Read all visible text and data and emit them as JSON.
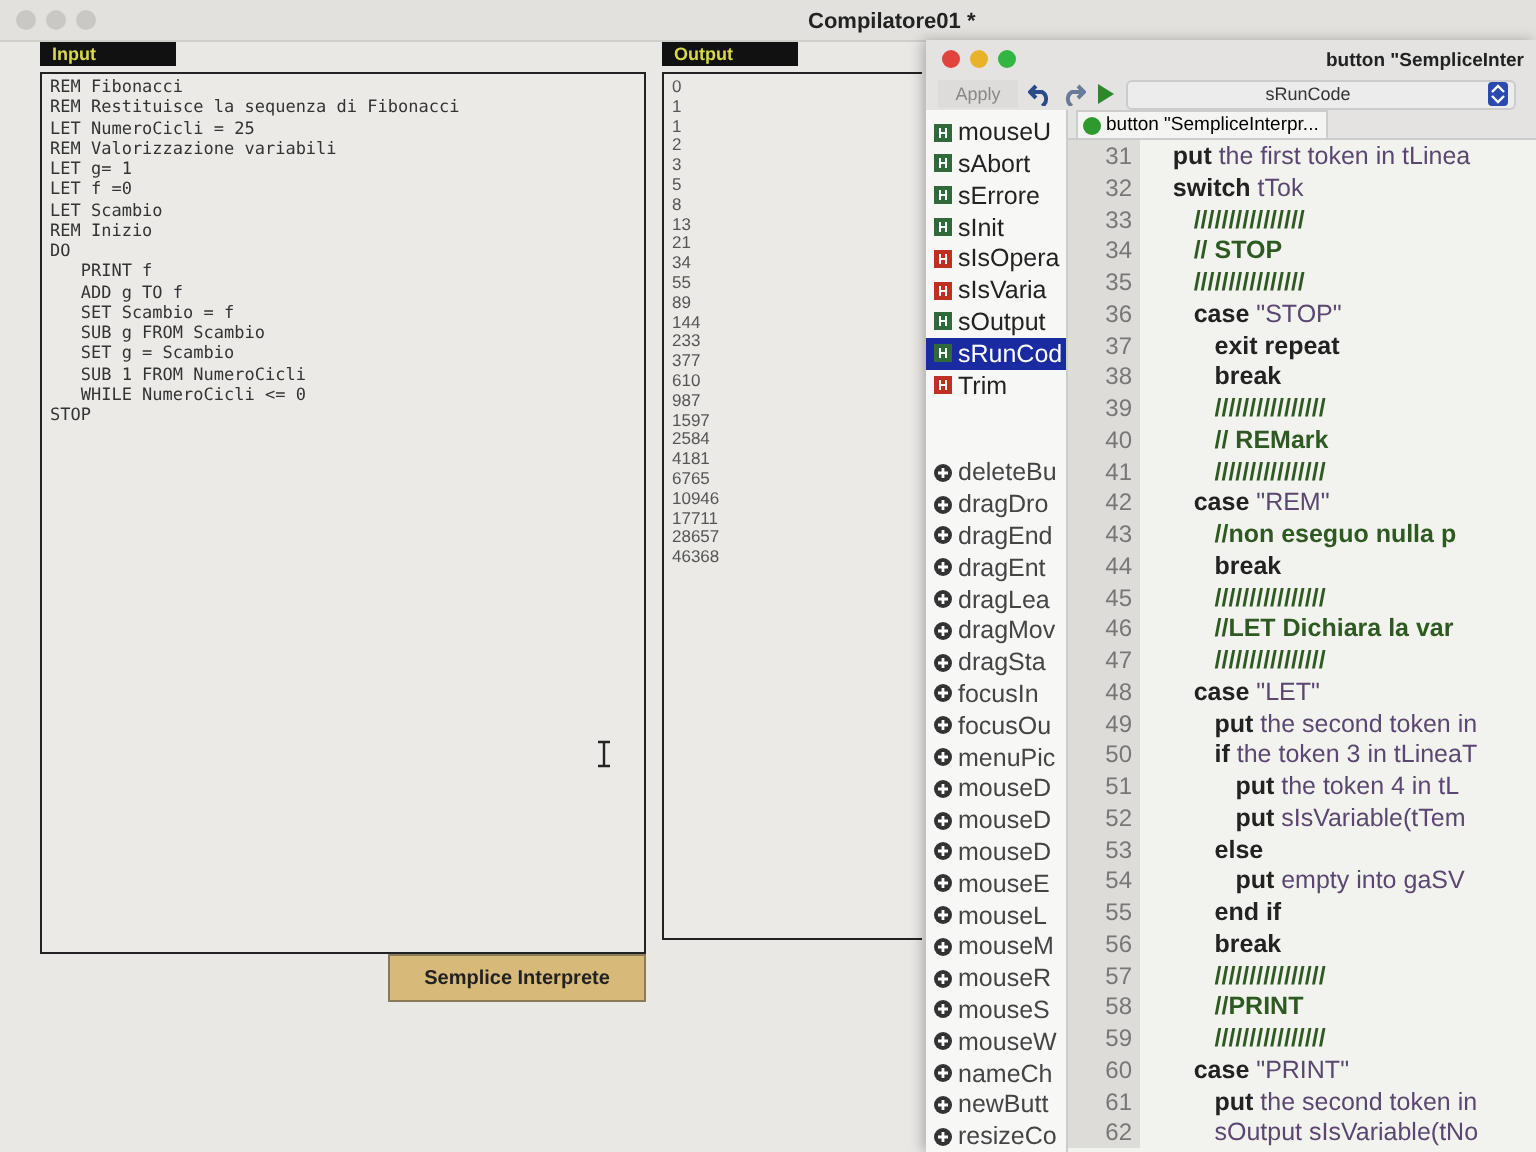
{
  "main_window": {
    "title": "Compilatore01 *"
  },
  "input": {
    "label": "Input",
    "lines": [
      "REM Fibonacci",
      "REM Restituisce la sequenza di Fibonacci",
      "LET NumeroCicli = 25",
      "REM Valorizzazione variabili",
      "LET g= 1",
      "LET f =0",
      "LET Scambio",
      "REM Inizio",
      "DO",
      "   PRINT f",
      "   ADD g TO f",
      "   SET Scambio = f",
      "   SUB g FROM Scambio",
      "   SET g = Scambio",
      "   SUB 1 FROM NumeroCicli",
      "   WHILE NumeroCicli <= 0",
      "STOP"
    ]
  },
  "output": {
    "label": "Output",
    "lines": [
      "0",
      "1",
      "1",
      "2",
      "3",
      "5",
      "8",
      "13",
      "21",
      "34",
      "55",
      "89",
      "144",
      "233",
      "377",
      "610",
      "987",
      "1597",
      "2584",
      "4181",
      "6765",
      "10946",
      "17711",
      "28657",
      "46368"
    ]
  },
  "run_button": {
    "label": "Semplice Interprete"
  },
  "editor": {
    "title": "button \"SempliceInter",
    "apply": "Apply",
    "handler_select": "sRunCode",
    "tab": "button \"SempliceInterpr...",
    "handlers": [
      {
        "name": "mouseU",
        "kind": "handler",
        "selected": false
      },
      {
        "name": "sAbort",
        "kind": "handler",
        "selected": false
      },
      {
        "name": "sErrore",
        "kind": "handler",
        "selected": false
      },
      {
        "name": "sInit",
        "kind": "handler",
        "selected": false
      },
      {
        "name": "sIsOpera",
        "kind": "function",
        "selected": false
      },
      {
        "name": "sIsVaria",
        "kind": "function",
        "selected": false
      },
      {
        "name": "sOutput",
        "kind": "handler",
        "selected": false
      },
      {
        "name": "sRunCod",
        "kind": "handler",
        "selected": true
      },
      {
        "name": "Trim",
        "kind": "function",
        "selected": false
      }
    ],
    "messages": [
      "deleteBu",
      "dragDro",
      "dragEnd",
      "dragEnt",
      "dragLea",
      "dragMov",
      "dragSta",
      "focusIn",
      "focusOu",
      "menuPic",
      "mouseD",
      "mouseD",
      "mouseD",
      "mouseE",
      "mouseL",
      "mouseM",
      "mouseR",
      "mouseS",
      "mouseW",
      "nameCh",
      "newButt",
      "resizeCo"
    ],
    "code": [
      {
        "number": "31",
        "kind": "code",
        "text": "   **put** the first token in tLinea"
      },
      {
        "number": "32",
        "kind": "code",
        "text": "   **switch** tTok"
      },
      {
        "number": "33",
        "kind": "comment",
        "text": "      ////////////////"
      },
      {
        "number": "34",
        "kind": "comment",
        "text": "      // STOP"
      },
      {
        "number": "35",
        "kind": "comment",
        "text": "      ////////////////"
      },
      {
        "number": "36",
        "kind": "code",
        "text": "      **case** \"STOP\""
      },
      {
        "number": "37",
        "kind": "code",
        "text": "         **exit repeat**"
      },
      {
        "number": "38",
        "kind": "code",
        "text": "         **break**"
      },
      {
        "number": "39",
        "kind": "comment",
        "text": "         ////////////////"
      },
      {
        "number": "40",
        "kind": "comment",
        "text": "         // REMark"
      },
      {
        "number": "41",
        "kind": "comment",
        "text": "         ////////////////"
      },
      {
        "number": "42",
        "kind": "code",
        "text": "      **case** \"REM\""
      },
      {
        "number": "43",
        "kind": "comment",
        "text": "         //non eseguo nulla p"
      },
      {
        "number": "44",
        "kind": "code",
        "text": "         **break**"
      },
      {
        "number": "45",
        "kind": "comment",
        "text": "         ////////////////"
      },
      {
        "number": "46",
        "kind": "comment",
        "text": "         //LET Dichiara la var"
      },
      {
        "number": "47",
        "kind": "comment",
        "text": "         ////////////////"
      },
      {
        "number": "48",
        "kind": "code",
        "text": "      **case** \"LET\""
      },
      {
        "number": "49",
        "kind": "code",
        "text": "         **put** the second token in"
      },
      {
        "number": "50",
        "kind": "code",
        "text": "         **if** the token 3 in tLineaT"
      },
      {
        "number": "51",
        "kind": "code",
        "text": "            **put** the token 4 in tL"
      },
      {
        "number": "52",
        "kind": "code",
        "text": "            **put** sIsVariable(tTem"
      },
      {
        "number": "53",
        "kind": "code",
        "text": "         **else**"
      },
      {
        "number": "54",
        "kind": "code",
        "text": "            **put** empty into gaSV"
      },
      {
        "number": "55",
        "kind": "code",
        "text": "         **end if**"
      },
      {
        "number": "56",
        "kind": "code",
        "text": "         **break**"
      },
      {
        "number": "57",
        "kind": "comment",
        "text": "         ////////////////"
      },
      {
        "number": "58",
        "kind": "comment",
        "text": "         //PRINT"
      },
      {
        "number": "59",
        "kind": "comment",
        "text": "         ////////////////"
      },
      {
        "number": "60",
        "kind": "code",
        "text": "      **case** \"PRINT\""
      },
      {
        "number": "61",
        "kind": "code",
        "text": "         **put** the second token in"
      },
      {
        "number": "62",
        "kind": "code",
        "text": "         sOutput sIsVariable(tNo"
      }
    ]
  }
}
